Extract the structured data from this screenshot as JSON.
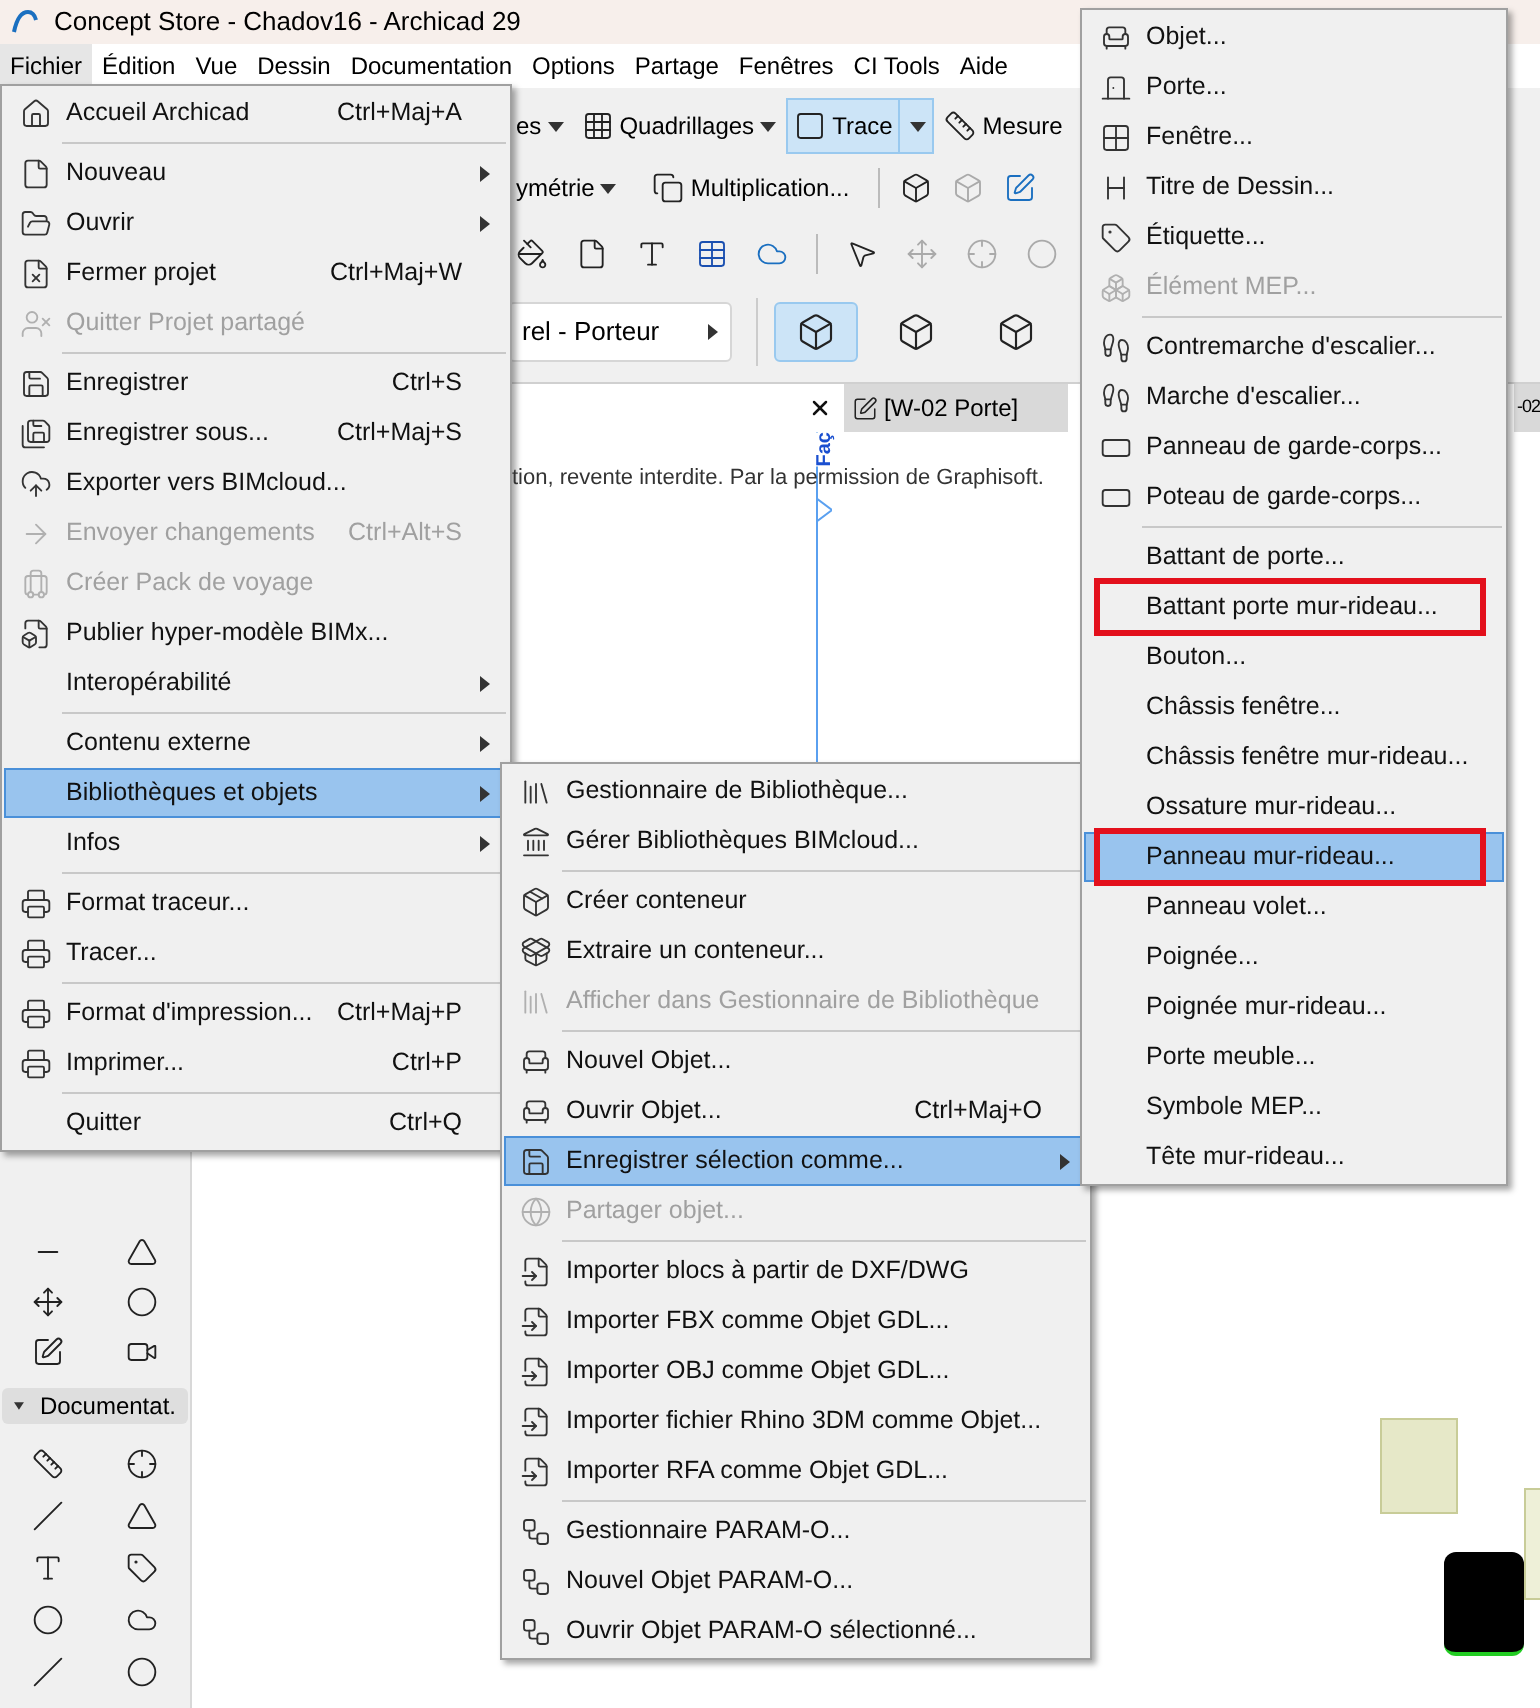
{
  "window": {
    "title": "Concept Store - Chadov16 - Archicad 29"
  },
  "menu_bar": [
    {
      "label": "Fichier",
      "selected": true
    },
    {
      "label": "Édition",
      "selected": false
    },
    {
      "label": "Vue",
      "selected": false
    },
    {
      "label": "Dessin",
      "selected": false
    },
    {
      "label": "Documentation",
      "selected": false
    },
    {
      "label": "Options",
      "selected": false
    },
    {
      "label": "Partage",
      "selected": false
    },
    {
      "label": "Fenêtres",
      "selected": false
    },
    {
      "label": "CI Tools",
      "selected": false
    },
    {
      "label": "Aide",
      "selected": false
    }
  ],
  "toolbar": {
    "row_1": [
      {
        "kind": "dropdown",
        "label": "es",
        "selected": false
      },
      {
        "kind": "dropdown",
        "label": "Quadrillages",
        "selected": false
      },
      {
        "kind": "split",
        "label": "Trace",
        "selected": true
      },
      {
        "kind": "button",
        "label": "Mesure",
        "selected": false
      }
    ],
    "row_2": [
      {
        "kind": "dropdown",
        "label": "ymétrie",
        "selected": false
      },
      {
        "kind": "button",
        "label": "Multiplication...",
        "selected": false
      }
    ],
    "structure": {
      "value": "rel - Porteur"
    },
    "geometry_options": [
      {
        "selected": true
      },
      {
        "selected": false
      },
      {
        "selected": false
      }
    ]
  },
  "tabs": [
    {
      "label": "[W-02 Porte]"
    },
    {
      "label": "-02"
    }
  ],
  "canvas": {
    "notice": "tion, revente interdite. Par la permission de Graphisoft.",
    "marker_label": "Faç"
  },
  "toolbox": {
    "section": {
      "title": "Documentat.",
      "expanded": true
    }
  },
  "file_menu": {
    "items": [
      {
        "kind": "item",
        "label": "Accueil Archicad",
        "shortcut": "Ctrl+Maj+A",
        "submenu": false,
        "disabled": false,
        "selected": false
      },
      {
        "kind": "separator"
      },
      {
        "kind": "item",
        "label": "Nouveau",
        "submenu": true,
        "disabled": false,
        "selected": false
      },
      {
        "kind": "item",
        "label": "Ouvrir",
        "submenu": true,
        "disabled": false,
        "selected": false
      },
      {
        "kind": "item",
        "label": "Fermer projet",
        "shortcut": "Ctrl+Maj+W",
        "submenu": false,
        "disabled": false,
        "selected": false
      },
      {
        "kind": "item",
        "label": "Quitter Projet partagé",
        "submenu": false,
        "disabled": true,
        "selected": false
      },
      {
        "kind": "separator"
      },
      {
        "kind": "item",
        "label": "Enregistrer",
        "shortcut": "Ctrl+S",
        "submenu": false,
        "disabled": false,
        "selected": false
      },
      {
        "kind": "item",
        "label": "Enregistrer sous...",
        "shortcut": "Ctrl+Maj+S",
        "submenu": false,
        "disabled": false,
        "selected": false
      },
      {
        "kind": "item",
        "label": "Exporter vers BIMcloud...",
        "submenu": false,
        "disabled": false,
        "selected": false
      },
      {
        "kind": "item",
        "label": "Envoyer changements",
        "shortcut": "Ctrl+Alt+S",
        "submenu": false,
        "disabled": true,
        "selected": false
      },
      {
        "kind": "item",
        "label": "Créer Pack de voyage",
        "submenu": false,
        "disabled": true,
        "selected": false
      },
      {
        "kind": "item",
        "label": "Publier hyper-modèle BIMx...",
        "submenu": false,
        "disabled": false,
        "selected": false
      },
      {
        "kind": "item",
        "label": "Interopérabilité",
        "submenu": true,
        "disabled": false,
        "selected": false
      },
      {
        "kind": "separator"
      },
      {
        "kind": "item",
        "label": "Contenu externe",
        "submenu": true,
        "disabled": false,
        "selected": false
      },
      {
        "kind": "item",
        "label": "Bibliothèques et objets",
        "submenu": true,
        "disabled": false,
        "selected": true
      },
      {
        "kind": "item",
        "label": "Infos",
        "submenu": true,
        "disabled": false,
        "selected": false
      },
      {
        "kind": "separator"
      },
      {
        "kind": "item",
        "label": "Format traceur...",
        "submenu": false,
        "disabled": false,
        "selected": false
      },
      {
        "kind": "item",
        "label": "Tracer...",
        "submenu": false,
        "disabled": false,
        "selected": false
      },
      {
        "kind": "separator"
      },
      {
        "kind": "item",
        "label": "Format d'impression...",
        "shortcut": "Ctrl+Maj+P",
        "submenu": false,
        "disabled": false,
        "selected": false
      },
      {
        "kind": "item",
        "label": "Imprimer...",
        "shortcut": "Ctrl+P",
        "submenu": false,
        "disabled": false,
        "selected": false
      },
      {
        "kind": "separator"
      },
      {
        "kind": "item",
        "label": "Quitter",
        "shortcut": "Ctrl+Q",
        "submenu": false,
        "disabled": false,
        "selected": false
      }
    ]
  },
  "library_submenu": {
    "items": [
      {
        "kind": "item",
        "label": "Gestionnaire de Bibliothèque...",
        "submenu": false,
        "disabled": false,
        "selected": false
      },
      {
        "kind": "item",
        "label": "Gérer Bibliothèques BIMcloud...",
        "submenu": false,
        "disabled": false,
        "selected": false
      },
      {
        "kind": "separator"
      },
      {
        "kind": "item",
        "label": "Créer conteneur",
        "submenu": false,
        "disabled": false,
        "selected": false
      },
      {
        "kind": "item",
        "label": "Extraire un conteneur...",
        "submenu": false,
        "disabled": false,
        "selected": false
      },
      {
        "kind": "item",
        "label": "Afficher dans Gestionnaire de Bibliothèque",
        "submenu": false,
        "disabled": true,
        "selected": false
      },
      {
        "kind": "separator"
      },
      {
        "kind": "item",
        "label": "Nouvel Objet...",
        "submenu": false,
        "disabled": false,
        "selected": false
      },
      {
        "kind": "item",
        "label": "Ouvrir Objet...",
        "shortcut": "Ctrl+Maj+O",
        "submenu": false,
        "disabled": false,
        "selected": false
      },
      {
        "kind": "item",
        "label": "Enregistrer sélection comme...",
        "submenu": true,
        "disabled": false,
        "selected": true
      },
      {
        "kind": "item",
        "label": "Partager objet...",
        "submenu": false,
        "disabled": true,
        "selected": false
      },
      {
        "kind": "separator"
      },
      {
        "kind": "item",
        "label": "Importer blocs à partir de DXF/DWG",
        "submenu": false,
        "disabled": false,
        "selected": false
      },
      {
        "kind": "item",
        "label": "Importer FBX comme Objet GDL...",
        "submenu": false,
        "disabled": false,
        "selected": false
      },
      {
        "kind": "item",
        "label": "Importer OBJ comme Objet GDL...",
        "submenu": false,
        "disabled": false,
        "selected": false
      },
      {
        "kind": "item",
        "label": "Importer fichier Rhino 3DM comme Objet...",
        "submenu": false,
        "disabled": false,
        "selected": false
      },
      {
        "kind": "item",
        "label": "Importer RFA comme Objet GDL...",
        "submenu": false,
        "disabled": false,
        "selected": false
      },
      {
        "kind": "separator"
      },
      {
        "kind": "item",
        "label": "Gestionnaire PARAM-O...",
        "submenu": false,
        "disabled": false,
        "selected": false
      },
      {
        "kind": "item",
        "label": "Nouvel Objet PARAM-O...",
        "submenu": false,
        "disabled": false,
        "selected": false
      },
      {
        "kind": "item",
        "label": "Ouvrir Objet PARAM-O sélectionné...",
        "submenu": false,
        "disabled": false,
        "selected": false
      }
    ]
  },
  "object_submenu": {
    "items": [
      {
        "kind": "item",
        "label": "Objet...",
        "disabled": false,
        "selected": false,
        "annotated": false
      },
      {
        "kind": "item",
        "label": "Porte...",
        "disabled": false,
        "selected": false,
        "annotated": false
      },
      {
        "kind": "item",
        "label": "Fenêtre...",
        "disabled": false,
        "selected": false,
        "annotated": false
      },
      {
        "kind": "item",
        "label": "Titre de Dessin...",
        "disabled": false,
        "selected": false,
        "annotated": false
      },
      {
        "kind": "item",
        "label": "Étiquette...",
        "disabled": false,
        "selected": false,
        "annotated": false
      },
      {
        "kind": "item",
        "label": "Élément MEP...",
        "disabled": true,
        "selected": false,
        "annotated": false
      },
      {
        "kind": "separator"
      },
      {
        "kind": "item",
        "label": "Contremarche d'escalier...",
        "disabled": false,
        "selected": false,
        "annotated": false
      },
      {
        "kind": "item",
        "label": "Marche d'escalier...",
        "disabled": false,
        "selected": false,
        "annotated": false
      },
      {
        "kind": "item",
        "label": "Panneau de garde-corps...",
        "disabled": false,
        "selected": false,
        "annotated": false
      },
      {
        "kind": "item",
        "label": "Poteau de garde-corps...",
        "disabled": false,
        "selected": false,
        "annotated": false
      },
      {
        "kind": "separator"
      },
      {
        "kind": "item",
        "label": "Battant de porte...",
        "disabled": false,
        "selected": false,
        "annotated": false
      },
      {
        "kind": "item",
        "label": "Battant porte mur-rideau...",
        "disabled": false,
        "selected": false,
        "annotated": true
      },
      {
        "kind": "item",
        "label": "Bouton...",
        "disabled": false,
        "selected": false,
        "annotated": false
      },
      {
        "kind": "item",
        "label": "Châssis fenêtre...",
        "disabled": false,
        "selected": false,
        "annotated": false
      },
      {
        "kind": "item",
        "label": "Châssis fenêtre mur-rideau...",
        "disabled": false,
        "selected": false,
        "annotated": false
      },
      {
        "kind": "item",
        "label": "Ossature mur-rideau...",
        "disabled": false,
        "selected": false,
        "annotated": false
      },
      {
        "kind": "item",
        "label": "Panneau mur-rideau...",
        "disabled": false,
        "selected": true,
        "annotated": true
      },
      {
        "kind": "item",
        "label": "Panneau volet...",
        "disabled": false,
        "selected": false,
        "annotated": false
      },
      {
        "kind": "item",
        "label": "Poignée...",
        "disabled": false,
        "selected": false,
        "annotated": false
      },
      {
        "kind": "item",
        "label": "Poignée mur-rideau...",
        "disabled": false,
        "selected": false,
        "annotated": false
      },
      {
        "kind": "item",
        "label": "Porte meuble...",
        "disabled": false,
        "selected": false,
        "annotated": false
      },
      {
        "kind": "item",
        "label": "Symbole MEP...",
        "disabled": false,
        "selected": false,
        "annotated": false
      },
      {
        "kind": "item",
        "label": "Tête mur-rideau...",
        "disabled": false,
        "selected": false,
        "annotated": false
      }
    ]
  }
}
